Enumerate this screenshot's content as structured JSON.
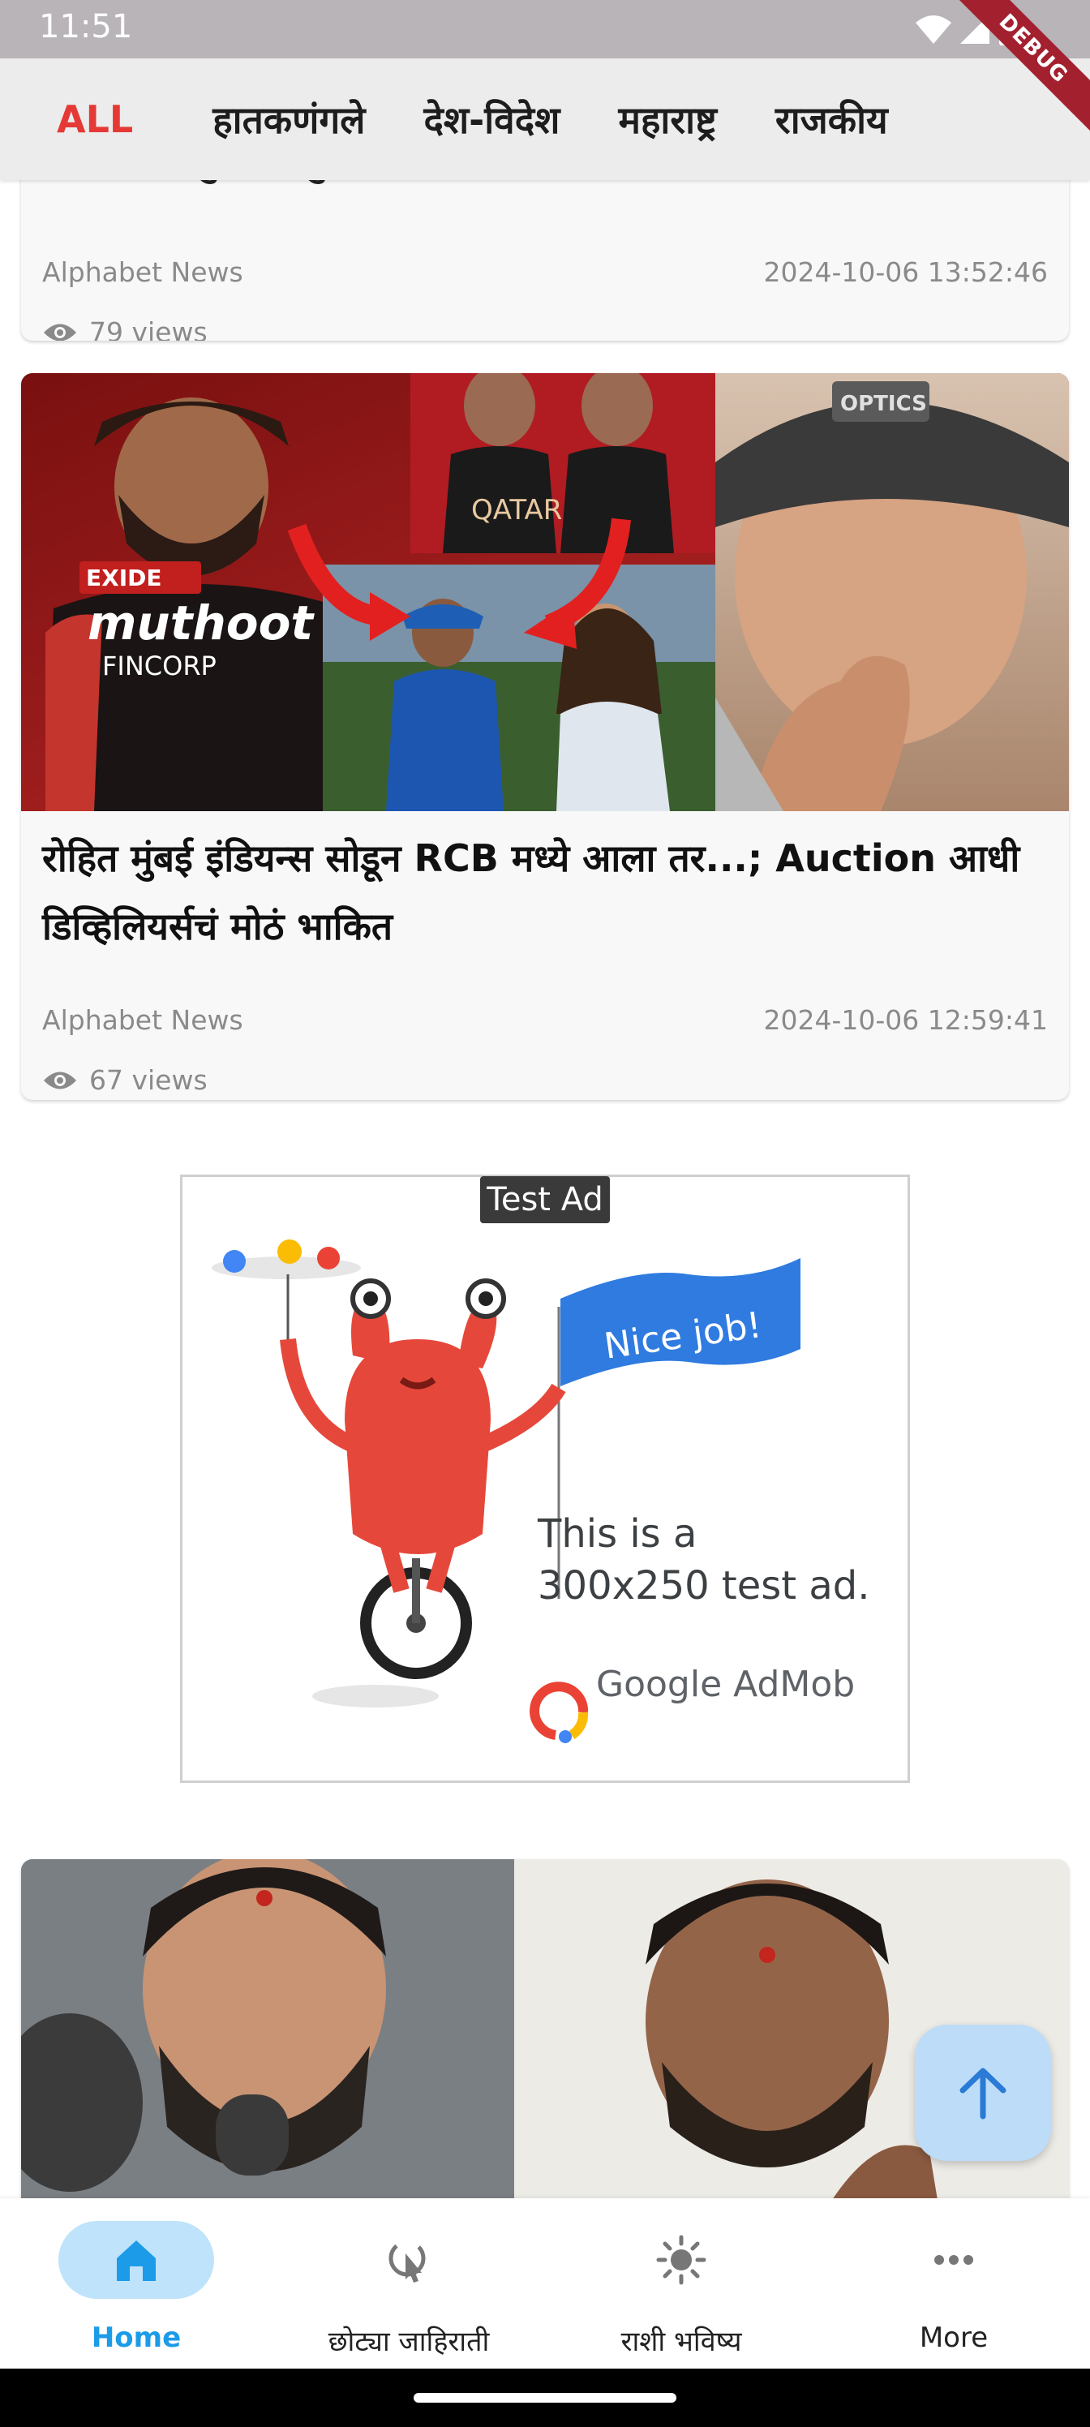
{
  "status_bar": {
    "time": "11:51",
    "debug_label": "DEBUG"
  },
  "tabs": [
    {
      "label": "ALL",
      "active": true
    },
    {
      "label": "हातकणंगले",
      "active": false
    },
    {
      "label": "देश-विदेश",
      "active": false
    },
    {
      "label": "महाराष्ट्र",
      "active": false
    },
    {
      "label": "राजकीय",
      "active": false
    }
  ],
  "articles": [
    {
      "title": "अल्पवयीन मुलीला सुपारी देत केले कांड",
      "source": "Alphabet News",
      "date": "2024-10-06 13:52:46",
      "views": "79 views"
    },
    {
      "title": "रोहित मुंबई इंडियन्स सोडून RCB मध्ये आला तर...; Auction आधी डिव्हिलियर्सचं मोठं भाकित",
      "source": "Alphabet News",
      "date": "2024-10-06 12:59:41",
      "views": "67 views",
      "image_text": {
        "sponsor1": "EXIDE",
        "sponsor2": "muthoot",
        "sponsor3": "FINCORP",
        "jersey": "QATAR",
        "cap": "OPTICS"
      }
    }
  ],
  "ad": {
    "label": "Test Ad",
    "flag_text": "Nice job!",
    "body": "This is a 300x250 test ad.",
    "brand": "Google AdMob"
  },
  "bottom_nav": [
    {
      "label": "Home",
      "icon": "home-icon",
      "active": true
    },
    {
      "label": "छोट्या जाहिराती",
      "icon": "cursor-click-icon",
      "active": false
    },
    {
      "label": "राशी भविष्य",
      "icon": "sun-icon",
      "active": false
    },
    {
      "label": "More",
      "icon": "more-horizontal-icon",
      "active": false
    }
  ],
  "colors": {
    "accent_red": "#e53935",
    "nav_active": "#1c9be8",
    "nav_pill": "#bfe3fb",
    "fab": "#bcdcf7"
  }
}
